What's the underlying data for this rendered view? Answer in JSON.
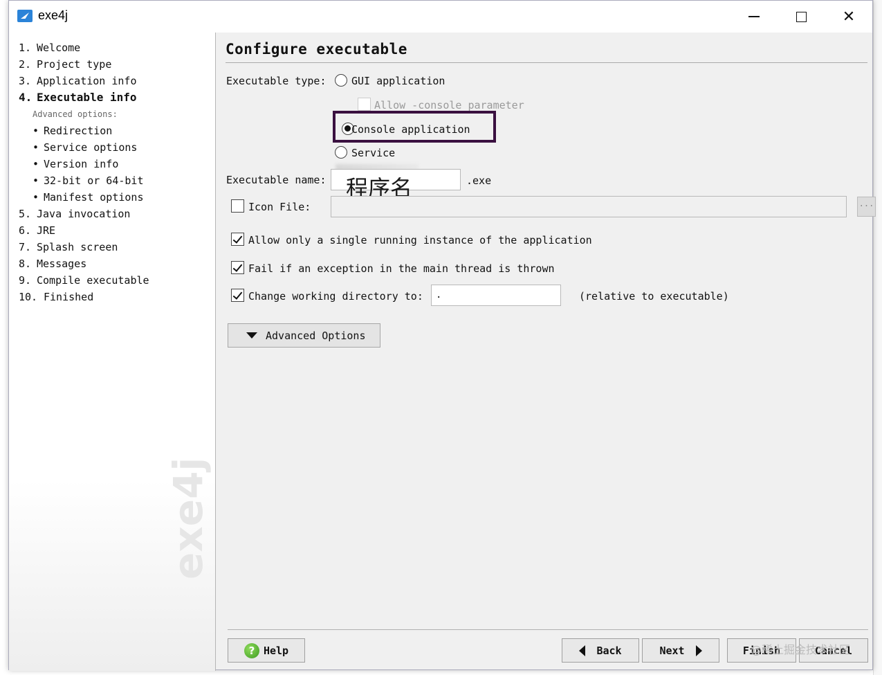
{
  "window": {
    "title": "exe4j"
  },
  "sidebar": {
    "steps": [
      {
        "num": "1.",
        "label": "Welcome"
      },
      {
        "num": "2.",
        "label": "Project type"
      },
      {
        "num": "3.",
        "label": "Application info"
      },
      {
        "num": "4.",
        "label": "Executable info"
      }
    ],
    "advanced_label": "Advanced options:",
    "sub_steps": [
      "Redirection",
      "Service options",
      "Version info",
      "32-bit or 64-bit",
      "Manifest options"
    ],
    "steps_after": [
      {
        "num": "5.",
        "label": "Java invocation"
      },
      {
        "num": "6.",
        "label": "JRE"
      },
      {
        "num": "7.",
        "label": "Splash screen"
      },
      {
        "num": "8.",
        "label": "Messages"
      },
      {
        "num": "9.",
        "label": "Compile executable"
      },
      {
        "num": "10.",
        "label": "Finished"
      }
    ],
    "bullet": "•",
    "watermark": "exe4j"
  },
  "main": {
    "title": "Configure executable",
    "exe_type_label": "Executable type:",
    "options": {
      "gui": "GUI application",
      "allow_console": "Allow -console parameter",
      "console": "Console application",
      "service": "Service"
    },
    "selected_type": "console",
    "exe_name_label": "Executable name:",
    "exe_name_value": "",
    "exe_ext": ".exe",
    "annotation": "程序名",
    "icon_file_label": "Icon File:",
    "icon_file_value": "",
    "browse_label": "...",
    "single_instance_label": "Allow only a single running instance of the application",
    "fail_exception_label": "Fail if an exception in the main thread is thrown",
    "change_dir_label": "Change working directory to:",
    "change_dir_value": ".",
    "relative_note": "(relative to executable)",
    "advanced_button": "Advanced Options"
  },
  "buttons": {
    "help": "Help",
    "back": "Back",
    "next": "Next",
    "finish": "Finish",
    "cancel": "Cancel"
  },
  "corner_watermark": "@稀土掘金技术社区"
}
